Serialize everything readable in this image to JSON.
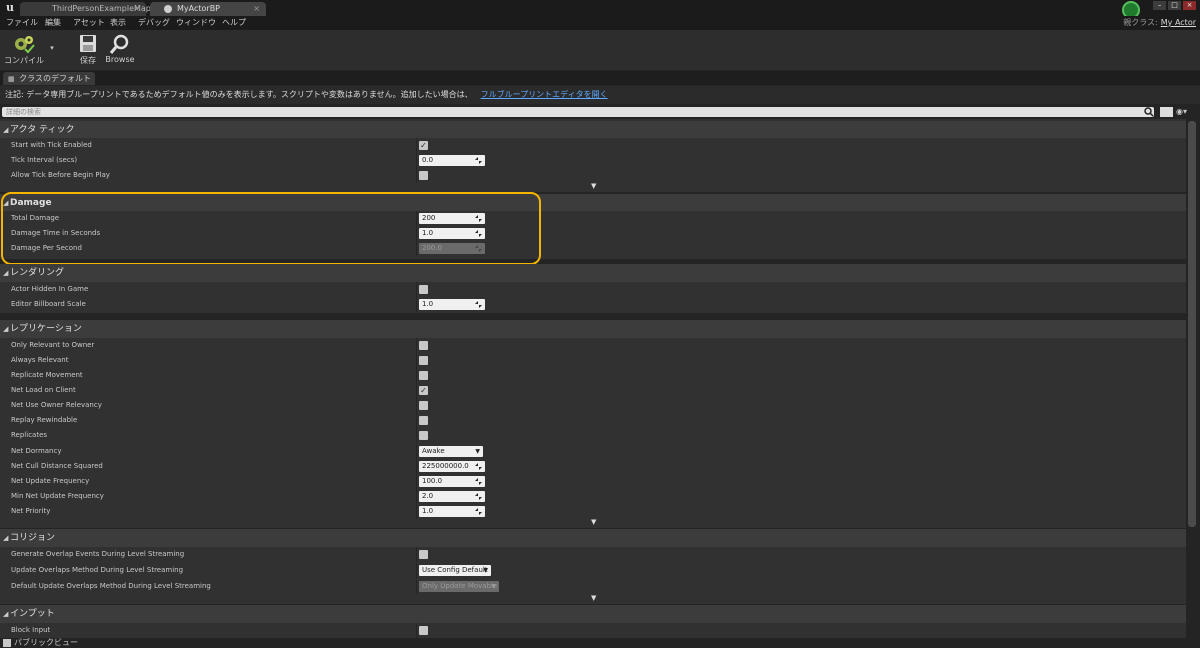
{
  "window": {
    "tabs": [
      {
        "label": "ThirdPersonExampleMap",
        "close": "×"
      },
      {
        "label": "MyActorBP",
        "close": "×"
      }
    ],
    "buttons": [
      "–",
      "□",
      "×"
    ]
  },
  "menu": [
    "ファイル",
    "編集",
    "アセット",
    "表示",
    "デバッグ",
    "ウィンドウ",
    "ヘルプ"
  ],
  "parent_class": {
    "label": "親クラス:",
    "value": "My Actor"
  },
  "toolbar": {
    "compile": "コンパイル",
    "save": "保存",
    "browse": "Browse"
  },
  "defaults_tab": "クラスのデフォルト",
  "notice": {
    "text": "注記:   データ専用ブループリントであるためデフォルト値のみを表示します。スクリプトや変数はありません。追加したい場合は、",
    "link": "フルブループリントエディタを開く"
  },
  "search": {
    "placeholder": "詳細の検索"
  },
  "sections": {
    "actor_tick": {
      "title": "アクタ ティック",
      "rows": [
        {
          "label": "Start with Tick Enabled",
          "checked": true
        },
        {
          "label": "Tick Interval (secs)",
          "value": "0.0"
        },
        {
          "label": "Allow Tick Before Begin Play",
          "checked": false
        }
      ]
    },
    "damage": {
      "title": "Damage",
      "rows": [
        {
          "label": "Total Damage",
          "value": "200"
        },
        {
          "label": "Damage Time in Seconds",
          "value": "1.0"
        },
        {
          "label": "Damage Per Second",
          "value": "200.0"
        }
      ]
    },
    "rendering": {
      "title": "レンダリング",
      "rows": [
        {
          "label": "Actor Hidden In Game",
          "checked": false
        },
        {
          "label": "Editor Billboard Scale",
          "value": "1.0"
        }
      ]
    },
    "replication": {
      "title": "レプリケーション",
      "rows": [
        {
          "label": "Only Relevant to Owner",
          "checked": false
        },
        {
          "label": "Always Relevant",
          "checked": false
        },
        {
          "label": "Replicate Movement",
          "checked": false
        },
        {
          "label": "Net Load on Client",
          "checked": true
        },
        {
          "label": "Net Use Owner Relevancy",
          "checked": false
        },
        {
          "label": "Replay Rewindable",
          "checked": false
        },
        {
          "label": "Replicates",
          "checked": false
        },
        {
          "label": "Net Dormancy",
          "value": "Awake"
        },
        {
          "label": "Net Cull Distance Squared",
          "value": "225000000.0"
        },
        {
          "label": "Net Update Frequency",
          "value": "100.0"
        },
        {
          "label": "Min Net Update Frequency",
          "value": "2.0"
        },
        {
          "label": "Net Priority",
          "value": "1.0"
        }
      ]
    },
    "collision": {
      "title": "コリジョン",
      "rows": [
        {
          "label": "Generate Overlap Events During Level Streaming",
          "checked": false
        },
        {
          "label": "Update Overlaps Method During Level Streaming",
          "value": "Use Config Default"
        },
        {
          "label": "Default Update Overlaps Method During Level Streaming",
          "value": "Only Update Movable"
        }
      ]
    },
    "input": {
      "title": "インプット",
      "rows": [
        {
          "label": "Block Input",
          "checked": false
        }
      ]
    }
  },
  "footer": {
    "public_view": "パブリックビュー"
  },
  "colors": {
    "highlight": "#f4b400",
    "link": "#5fa9ff",
    "badge": "#1f7a2e"
  }
}
